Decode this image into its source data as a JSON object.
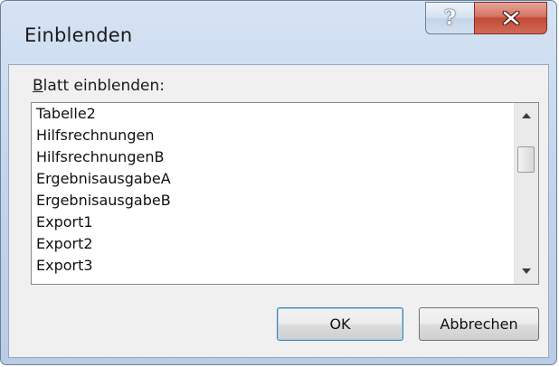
{
  "window": {
    "title": "Einblenden",
    "help_symbol": "?",
    "close_symbol": "x"
  },
  "group": {
    "label_accelerator": "B",
    "label_rest": "latt einblenden:"
  },
  "list": {
    "items": [
      "Tabelle2",
      "Hilfsrechnungen",
      "HilfsrechnungenB",
      "ErgebnisausgabeA",
      "ErgebnisausgabeB",
      "Export1",
      "Export2",
      "Export3"
    ],
    "scroll_up_icon": "scroll-up-arrow",
    "scroll_down_icon": "scroll-down-arrow"
  },
  "buttons": {
    "ok_label": "OK",
    "cancel_label": "Abbrechen"
  },
  "colors": {
    "frame": "#c4d6ee",
    "close_button": "#c24a36",
    "default_button_border": "#3c7fb1"
  }
}
